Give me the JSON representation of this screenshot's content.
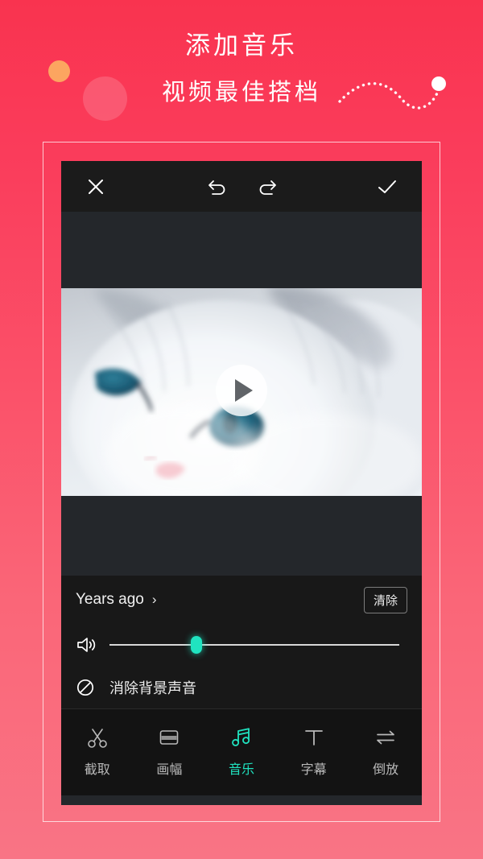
{
  "promo": {
    "title": "添加音乐",
    "subtitle": "视频最佳搭档",
    "bg_top_color": "#F9334F",
    "bg_bottom_color": "#F97485",
    "accent_color": "#20E3C0",
    "decor": {
      "small_circle_color": "#FCA560",
      "large_circle_color": "rgba(255,255,255,0.16)",
      "end_dot_color": "#FFFFFF"
    }
  },
  "editor": {
    "top_bar": {
      "close_icon": "close-icon",
      "undo_icon": "undo-icon",
      "redo_icon": "redo-icon",
      "confirm_icon": "check-icon"
    },
    "preview": {
      "play_icon": "play-icon",
      "subject": "white fluffy cat with blue eyes"
    },
    "music": {
      "track_name": "Years ago",
      "chevron": "›",
      "clear_label": "清除",
      "volume_icon": "volume-icon",
      "volume_percent": 30,
      "mute_icon": "ban-icon",
      "mute_label": "消除背景声音"
    },
    "tabs": [
      {
        "label": "截取",
        "icon": "scissors-icon",
        "active": false
      },
      {
        "label": "画幅",
        "icon": "frame-icon",
        "active": false
      },
      {
        "label": "音乐",
        "icon": "music-note-icon",
        "active": true
      },
      {
        "label": "字幕",
        "icon": "text-t-icon",
        "active": false
      },
      {
        "label": "倒放",
        "icon": "reverse-arrows-icon",
        "active": false
      }
    ]
  }
}
